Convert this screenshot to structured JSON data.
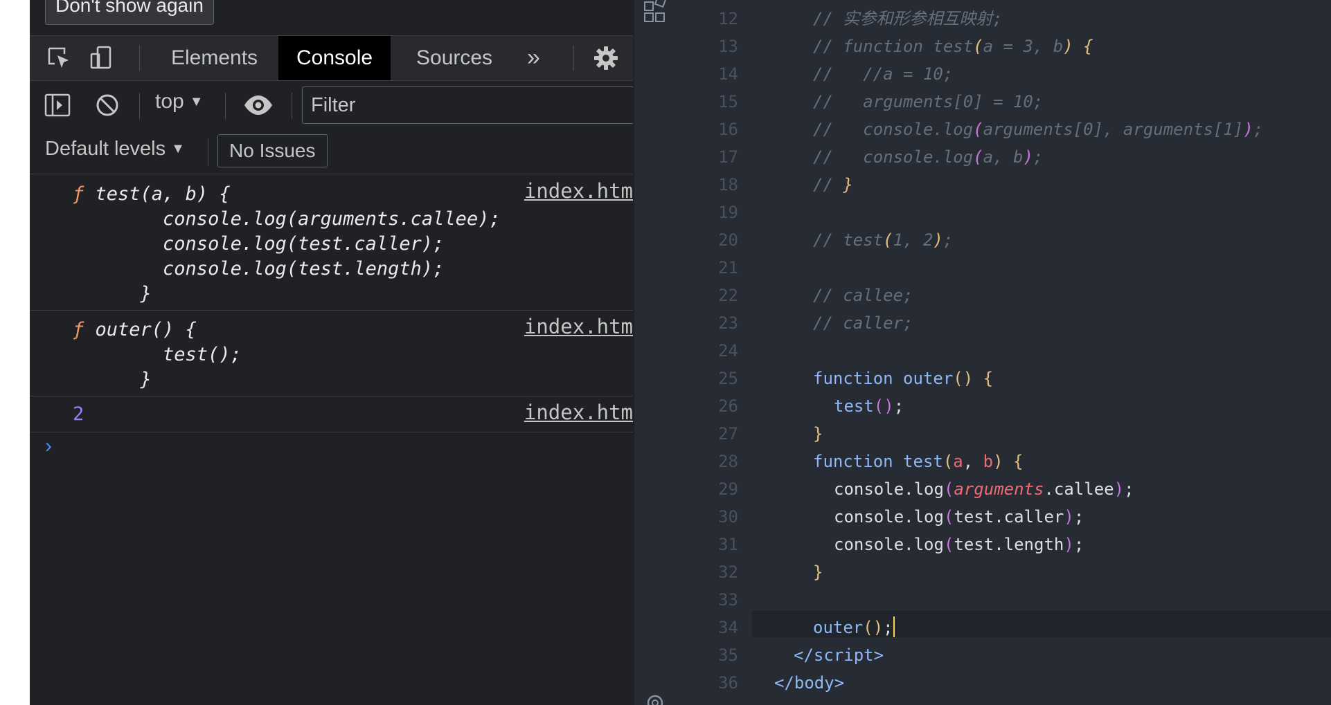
{
  "banner": {
    "dont_show_label": "Don't show again"
  },
  "devtools": {
    "tabs": [
      {
        "label": "Elements",
        "active": false
      },
      {
        "label": "Console",
        "active": true
      },
      {
        "label": "Sources",
        "active": false
      }
    ],
    "more_tabs_label": "»",
    "toolbar": {
      "context": "top",
      "filter_placeholder": "Filter"
    },
    "levels": {
      "label": "Default levels",
      "issues_label": "No Issues"
    },
    "messages": [
      {
        "source": "index.htm",
        "keyword": "ƒ",
        "lines": [
          " test(a, b) {",
          "        console.log(arguments.callee);",
          "        console.log(test.caller);",
          "        console.log(test.length);",
          "      }"
        ]
      },
      {
        "source": "index.htm",
        "keyword": "ƒ",
        "lines": [
          " outer() {",
          "        test();",
          "      }"
        ]
      },
      {
        "source": "index.htm",
        "value": "2"
      }
    ],
    "prompt_symbol": "›"
  },
  "editor": {
    "line_numbers": [
      "12",
      "13",
      "14",
      "15",
      "16",
      "17",
      "18",
      "19",
      "20",
      "21",
      "22",
      "23",
      "24",
      "25",
      "26",
      "27",
      "28",
      "29",
      "30",
      "31",
      "32",
      "33",
      "34",
      "35",
      "36"
    ],
    "comment_12": "// 实参和形参相互映射;",
    "comment_14": "//   //a = 10;",
    "comment_15": "//   arguments[0] = 10;",
    "comment_22": "// callee;",
    "comment_23": "// caller;"
  },
  "colors": {
    "devtools_bg": "#202124",
    "editor_bg": "#262b34",
    "active_tab_bg": "#000000",
    "function_keyword": "#f29766",
    "number": "#9980ff"
  }
}
